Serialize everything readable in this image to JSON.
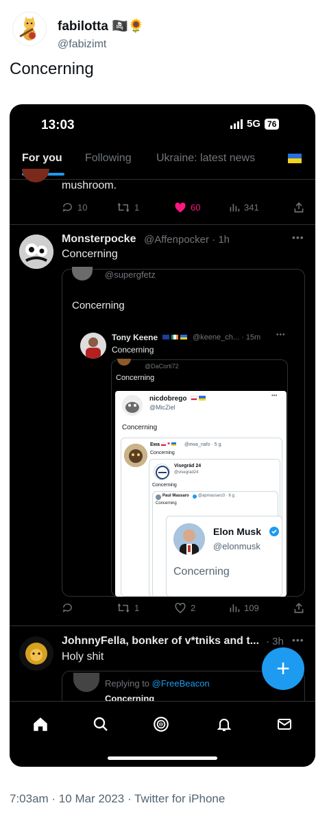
{
  "tweet": {
    "author_name": "fabilotta",
    "author_emoji": "🏴‍☠️🌻",
    "author_handle": "@fabizimt",
    "text": "Concerning",
    "footer": "7:03am · 10 Mar 2023 · Twitter for iPhone"
  },
  "screenshot": {
    "status_bar": {
      "time": "13:03",
      "network": "5G",
      "battery": "76"
    },
    "tabs": [
      {
        "label": "For you",
        "active": true
      },
      {
        "label": "Following",
        "active": false
      },
      {
        "label": "Ukraine: latest news",
        "active": false
      }
    ],
    "top_tweet": {
      "text": "mushroom.",
      "replies": "10",
      "retweets": "1",
      "likes": "60",
      "views": "341"
    },
    "main_tweet": {
      "name": "Monsterpocke",
      "handle": "@Affenpocker · 1h",
      "text": "Concerning",
      "quote1": {
        "handle": "@supergfetz",
        "text": "Concerning",
        "inner": {
          "name": "Tony Keene",
          "handle": "@keene_ch... · 15m",
          "text": "Concerning",
          "quote": {
            "handle": "@DaCorti72",
            "text": "Concerning",
            "card": {
              "name": "nicdobrego",
              "handle": "@MicZiel",
              "text": "Concerning",
              "ewa": {
                "name": "Ewa",
                "handle": "@ewa_nafo · 5 g.",
                "text": "Concerning",
                "visegrad": {
                  "name": "Visegrád 24",
                  "handle": "@visegrad24",
                  "text": "Concerning",
                  "paul": {
                    "name": "Paul Massaro",
                    "handle": "@apmassaro3 · 6 g.",
                    "text": "Concerning",
                    "musk": {
                      "name": "Elon Musk",
                      "handle": "@elonmusk",
                      "text": "Concerning"
                    }
                  }
                }
              }
            }
          }
        }
      },
      "retweets": "1",
      "likes": "2",
      "views": "109"
    },
    "third_tweet": {
      "name": "JohnnyFella, bonker of v*tniks and t...",
      "time": "· 3h",
      "text": "Holy shit",
      "reply_label": "Replying to",
      "reply_handle": "@FreeBeacon",
      "quote_text": "Concerning"
    },
    "fab_label": "+",
    "nav_icons": [
      "home-icon",
      "search-icon",
      "spaces-icon",
      "notifications-icon",
      "messages-icon"
    ]
  }
}
